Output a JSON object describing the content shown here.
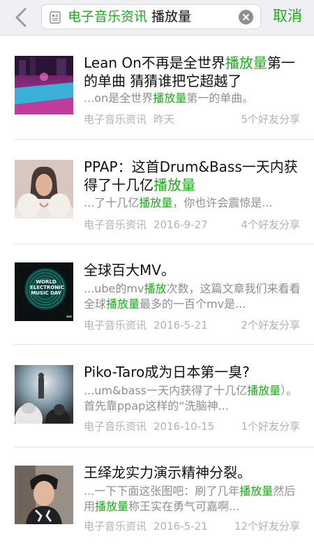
{
  "header": {
    "search_tag": "电子音乐资讯",
    "search_query": "播放量",
    "cancel_label": "取消"
  },
  "results": [
    {
      "title_pre": "Lean On不再是全世界",
      "title_hl": "播放量",
      "title_post": "第一的单曲 猜猜谁把它超越了",
      "snip_pre": "...on是全世界",
      "snip_hl": "播放量",
      "snip_post": "第一的单曲。",
      "source": "电子音乐资讯",
      "date": "昨天",
      "shares": "5个好友分享"
    },
    {
      "title_pre": "PPAP：这首Drum&Bass一天内获得了十几亿",
      "title_hl": "播放量",
      "title_post": "",
      "snip_pre": "...了十几亿",
      "snip_hl": "播放量",
      "snip_post": "，你也许会震惊是...",
      "source": "电子音乐资讯",
      "date": "2016-9-27",
      "shares": "4个好友分享"
    },
    {
      "title_pre": "全球百大MV。",
      "title_hl": "",
      "title_post": "",
      "snip_pre": "...ube的mv",
      "snip_hl": "播放",
      "snip_post": "次数，这篇文章我们来看看全球",
      "snip_hl2": "播放量",
      "snip_post2": "最多的一百个mv是...",
      "source": "电子音乐资讯",
      "date": "2016-5-21",
      "shares": "2个好友分享",
      "thumb_text": "WORLD ELECTRONIC MUSIC DAY"
    },
    {
      "title_pre": "Piko-Taro成为日本第一臭?",
      "title_hl": "",
      "title_post": "",
      "snip_pre": "...um&bass一天内获得了十几亿",
      "snip_hl": "播放量",
      "snip_post": "）。首先靠ppap这样的“洗脑神...",
      "source": "电子音乐资讯",
      "date": "2016-10-15",
      "shares": "1个好友分享"
    },
    {
      "title_pre": "王绎龙实力演示精神分裂。",
      "title_hl": "",
      "title_post": "",
      "snip_pre": "...一下下面这张图吧：刷了几年",
      "snip_hl": "播放量",
      "snip_post": "然后用",
      "snip_hl2": "播放量",
      "snip_post2": "称王实在勇气可嘉啊...",
      "source": "电子音乐资讯",
      "date": "2016-5-21",
      "shares": "12个好友分享"
    }
  ]
}
